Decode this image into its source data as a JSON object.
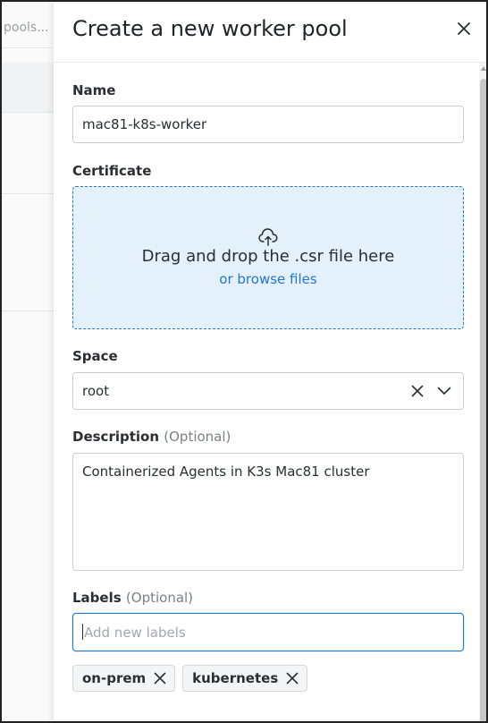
{
  "background": {
    "search_placeholder": "pools..."
  },
  "drawer": {
    "title": "Create a new worker pool",
    "close_icon": "close-icon"
  },
  "form": {
    "name": {
      "label": "Name",
      "value": "mac81-k8s-worker"
    },
    "certificate": {
      "label": "Certificate",
      "icon": "cloud-upload-icon",
      "drop_text": "Drag and drop the .csr file here",
      "browse_text": "or browse files"
    },
    "space": {
      "label": "Space",
      "value": "root",
      "clear_icon": "clear-icon",
      "dropdown_icon": "chevron-down-icon"
    },
    "description": {
      "label": "Description",
      "optional": "(Optional)",
      "value": "Containerized Agents in K3s Mac81 cluster"
    },
    "labels": {
      "label": "Labels",
      "optional": "(Optional)",
      "placeholder": "Add new labels",
      "tags": [
        {
          "text": "on-prem"
        },
        {
          "text": "kubernetes"
        }
      ]
    }
  },
  "colors": {
    "accent": "#1f78d1",
    "dropzone_bg": "#e4f0fa",
    "border": "#c9ccd1"
  }
}
